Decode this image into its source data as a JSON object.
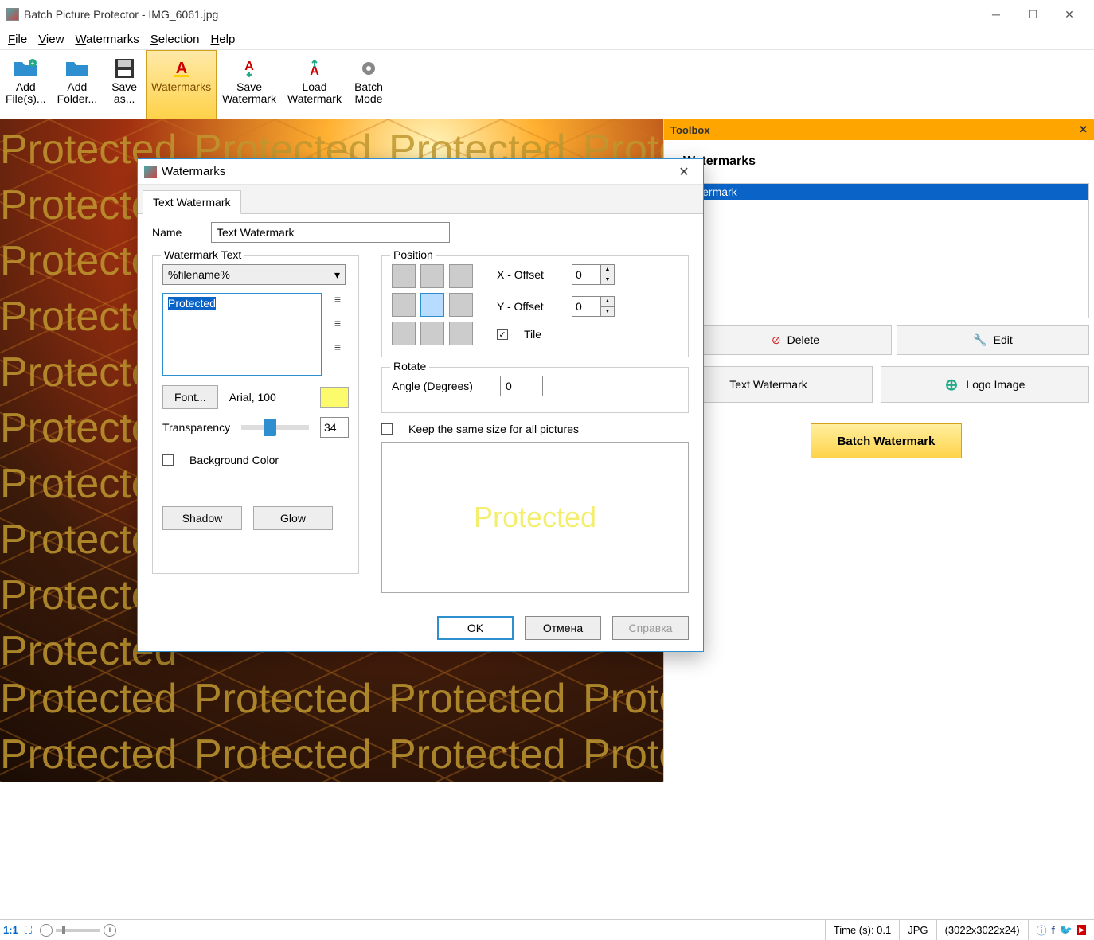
{
  "window": {
    "title": "Batch Picture Protector - IMG_6061.jpg"
  },
  "menu": {
    "file": "File",
    "view": "View",
    "watermarks": "Watermarks",
    "selection": "Selection",
    "help": "Help"
  },
  "toolbar": {
    "add_files": "Add\nFile(s)...",
    "add_folder": "Add\nFolder...",
    "save_as": "Save\nas...",
    "watermarks": "Watermarks",
    "save_wm": "Save\nWatermark",
    "load_wm": "Load\nWatermark",
    "batch_mode": "Batch\nMode"
  },
  "preview_wm": "Protected",
  "toolbox": {
    "title": "Toolbox",
    "header": "Watermarks",
    "list_item": "xt Watermark",
    "delete": "Delete",
    "edit": "Edit",
    "text_wm": "Text Watermark",
    "logo_img": "Logo Image",
    "batch": "Batch Watermark"
  },
  "dialog": {
    "title": "Watermarks",
    "tab": "Text Watermark",
    "name_label": "Name",
    "name_value": "Text Watermark",
    "wm_text_legend": "Watermark Text",
    "macro_selected": "%filename%",
    "text_value": "Protected",
    "font_btn": "Font...",
    "font_desc": "Arial, 100",
    "transparency_label": "Transparency",
    "transparency_value": "34",
    "bg_color": "Background Color",
    "shadow": "Shadow",
    "glow": "Glow",
    "position_legend": "Position",
    "x_offset": "X - Offset",
    "y_offset": "Y - Offset",
    "x_val": "0",
    "y_val": "0",
    "tile": "Tile",
    "rotate_legend": "Rotate",
    "angle_label": "Angle (Degrees)",
    "angle_value": "0",
    "keep_size": "Keep the same size for all pictures",
    "preview_text": "Protected",
    "ok": "OK",
    "cancel": "Отмена",
    "help": "Справка"
  },
  "status": {
    "scale": "1:1",
    "time": "Time (s): 0.1",
    "format": "JPG",
    "dims": "(3022x3022x24)"
  }
}
